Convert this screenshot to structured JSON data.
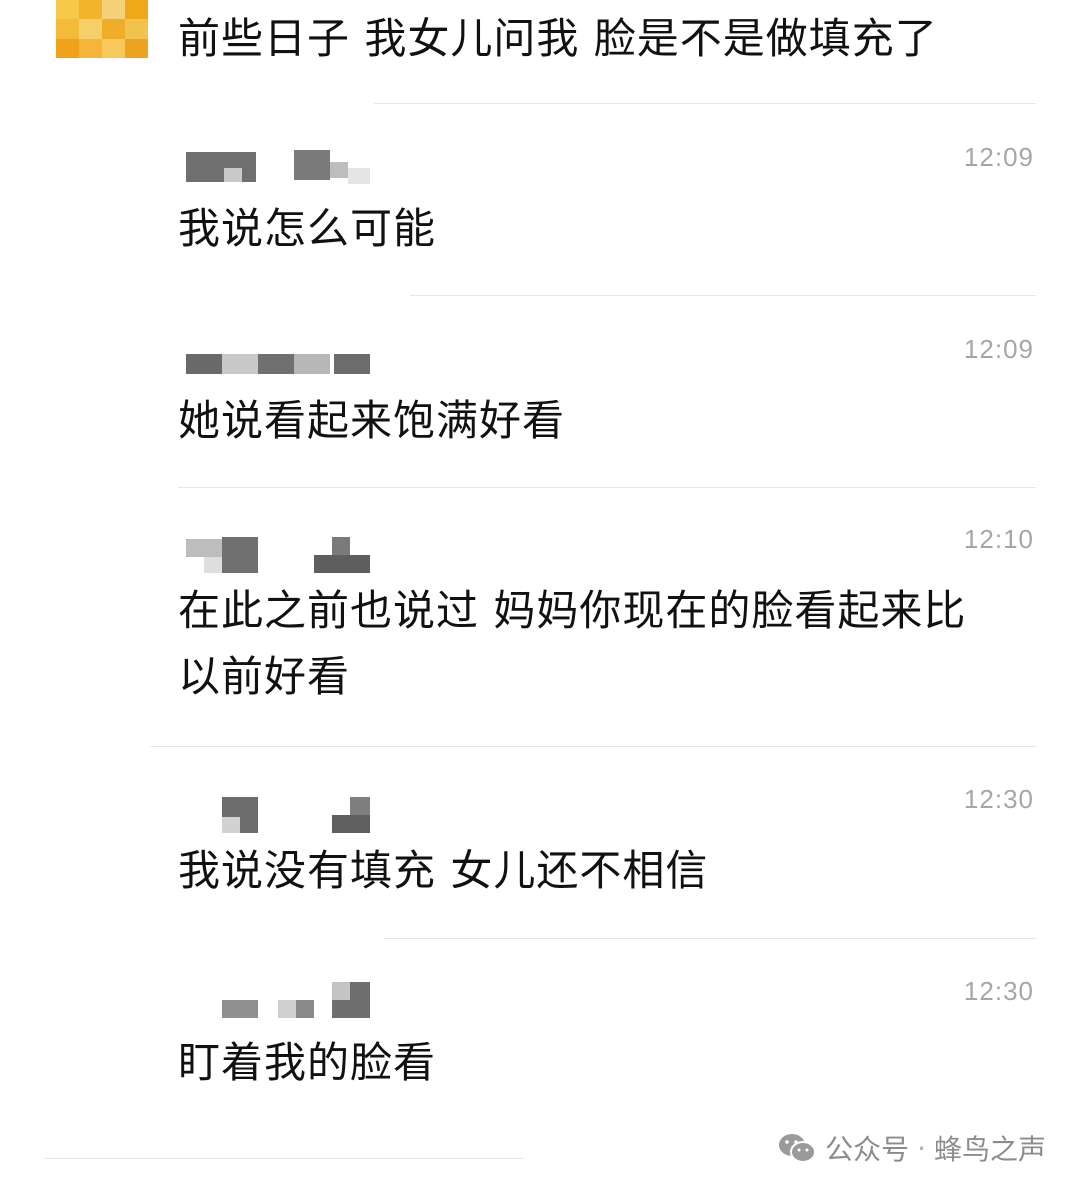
{
  "messages": [
    {
      "text": "前些日子 我女儿问我 脸是不是做填充了"
    },
    {
      "text": "我说怎么可能",
      "time": "12:09"
    },
    {
      "text": "她说看起来饱满好看",
      "time": "12:09"
    },
    {
      "text": "在此之前也说过 妈妈你现在的脸看起来比以前好看",
      "time": "12:10"
    },
    {
      "text": "我说没有填充 女儿还不相信",
      "time": "12:30"
    },
    {
      "text": "盯着我的脸看",
      "time": "12:30"
    }
  ],
  "footer": {
    "icon": "wechat-icon",
    "label": "公众号",
    "separator": "·",
    "account": "蜂鸟之声"
  },
  "colors": {
    "text": "#111111",
    "time": "#a6a6a6",
    "divider": "#e6e6e6",
    "avatar": "#f0b020"
  }
}
